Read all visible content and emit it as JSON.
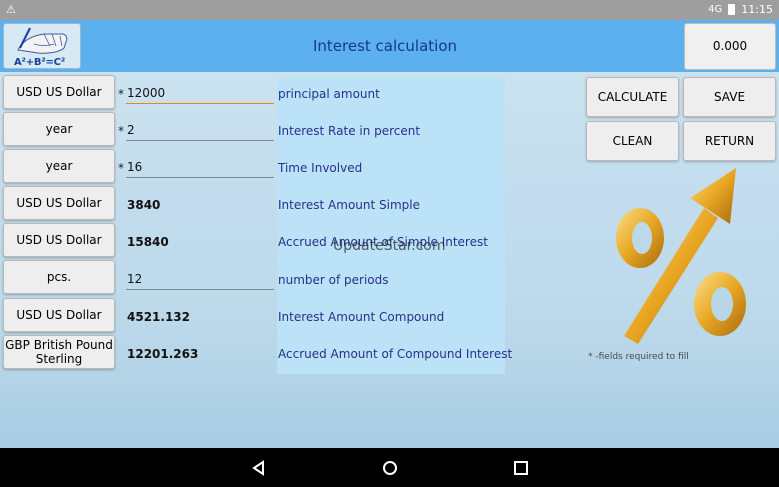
{
  "status_bar": {
    "time": "11:15",
    "signal": "4G",
    "warning_glyph": "⚠"
  },
  "header": {
    "title": "Interest calculation",
    "result": "0.000",
    "logo_formula": "A²+B²=C²"
  },
  "rows": [
    {
      "unit": "USD US Dollar",
      "required": true,
      "value": "12000",
      "label": "principal amount"
    },
    {
      "unit": "year",
      "required": true,
      "value": "2",
      "label": "Interest Rate in percent"
    },
    {
      "unit": "year",
      "required": true,
      "value": "16",
      "label": "Time Involved"
    },
    {
      "unit": "USD US Dollar",
      "required": false,
      "value": "3840",
      "label": "Interest Amount Simple"
    },
    {
      "unit": "USD US Dollar",
      "required": false,
      "value": "15840",
      "label": "Accrued Amount of Simple Interest"
    },
    {
      "unit": "pcs.",
      "required": false,
      "value": "12",
      "label": "number of periods"
    },
    {
      "unit": "USD US Dollar",
      "required": false,
      "value": "4521.132",
      "label": "Interest Amount Compound"
    },
    {
      "unit": "GBP British Pound\nSterling",
      "required": false,
      "value": "12201.263",
      "label": "Accrued Amount of Compound Interest"
    }
  ],
  "required_marker": "*",
  "buttons": {
    "calculate": "CALCULATE",
    "save": "SAVE",
    "clean": "CLEAN",
    "return": "RETURN"
  },
  "watermark": "UpdateStar.com",
  "required_note": "* -fields required to fill",
  "icons": {
    "percent_art": "percent-growth-arrow-icon",
    "back": "back-triangle-icon",
    "home": "home-circle-icon",
    "recents": "recents-square-icon"
  },
  "colors": {
    "header": "#5db0ee",
    "panel": "#bce2f8",
    "label_text": "#26318a",
    "gold": "#e8a623"
  }
}
